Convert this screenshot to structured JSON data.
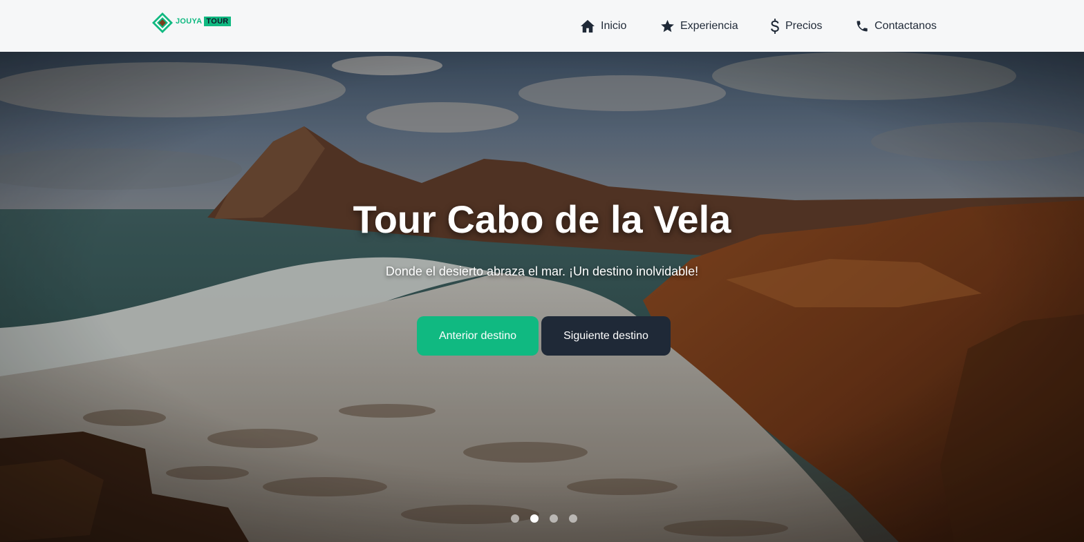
{
  "brand": {
    "name_part1": "JOUYA",
    "name_part2": "TOUR",
    "logo_icon": "diamond-logo-icon",
    "accent_color": "#10b981",
    "dark_color": "#1f2937"
  },
  "nav": {
    "items": [
      {
        "label": "Inicio",
        "icon": "home-icon"
      },
      {
        "label": "Experiencia",
        "icon": "star-icon"
      },
      {
        "label": "Precios",
        "icon": "dollar-icon"
      },
      {
        "label": "Contactanos",
        "icon": "phone-icon"
      }
    ]
  },
  "hero": {
    "title": "Tour Cabo de la Vela",
    "subtitle": "Donde el desierto abraza el mar. ¡Un destino inolvidable!",
    "prev_button": "Anterior destino",
    "next_button": "Siguiente destino",
    "slide_count": 4,
    "active_slide": 2
  }
}
